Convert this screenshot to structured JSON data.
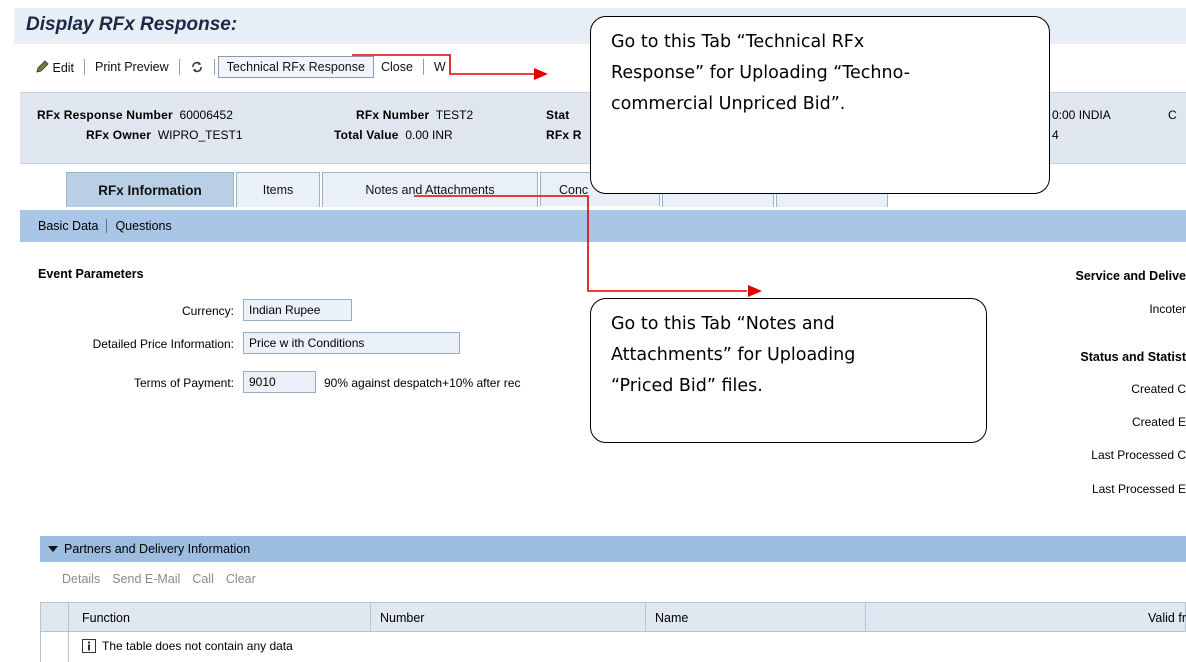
{
  "page": {
    "title": "Display RFx Response:"
  },
  "toolbar": {
    "edit": "Edit",
    "print_preview": "Print Preview",
    "technical_response": "Technical RFx Response",
    "close": "Close",
    "truncated": "W"
  },
  "header": {
    "response_number_label": "RFx Response Number",
    "response_number": "60006452",
    "rfx_number_label": "RFx Number",
    "rfx_number": "TEST2",
    "status_label_partial": "Stat",
    "owner_label": "RFx Owner",
    "owner": "WIPRO_TEST1",
    "total_value_label": "Total Value",
    "total_value": "0.00 INR",
    "rfx_r_partial": "RFx R",
    "right_line1": "0:00 INDIA",
    "right_line2": "4",
    "right_c": "C"
  },
  "tabs": [
    {
      "label": "RFx Information",
      "active": true
    },
    {
      "label": "Items",
      "active": false
    },
    {
      "label": "Notes and Attachments",
      "active": false
    },
    {
      "label": "Conc",
      "active": false
    }
  ],
  "subnav": {
    "basic_data": "Basic Data",
    "questions": "Questions"
  },
  "event_parameters": {
    "title": "Event Parameters",
    "currency_label": "Currency:",
    "currency": "Indian Rupee",
    "price_info_label": "Detailed Price Information:",
    "price_info": "Price w ith Conditions",
    "payment_label": "Terms of Payment:",
    "payment_code": "9010",
    "payment_text": "90% against despatch+10% after rec"
  },
  "right_panel": {
    "service_title": "Service and Delive",
    "incoterms": "Incoter",
    "status_title": "Status and Statist",
    "created_on": "Created C",
    "created_by": "Created E",
    "last_processed_on": "Last Processed C",
    "last_processed_by": "Last Processed E"
  },
  "callouts": {
    "technical": [
      "Go to this Tab “Technical RFx",
      "Response” for Uploading “Techno-",
      "commercial Unpriced Bid”."
    ],
    "notes": [
      "Go to this Tab “Notes and",
      "Attachments” for Uploading",
      "“Priced Bid” files."
    ]
  },
  "partners": {
    "title": "Partners and Delivery Information",
    "actions": [
      "Details",
      "Send E-Mail",
      "Call",
      "Clear"
    ],
    "columns": [
      "Function",
      "Number",
      "Name",
      "Valid fr"
    ],
    "empty_message": "The table does not contain any data"
  },
  "colors": {
    "arrow": "#e00000",
    "subnav": "#a9c6e6",
    "header_bg": "#dfe6ef"
  }
}
